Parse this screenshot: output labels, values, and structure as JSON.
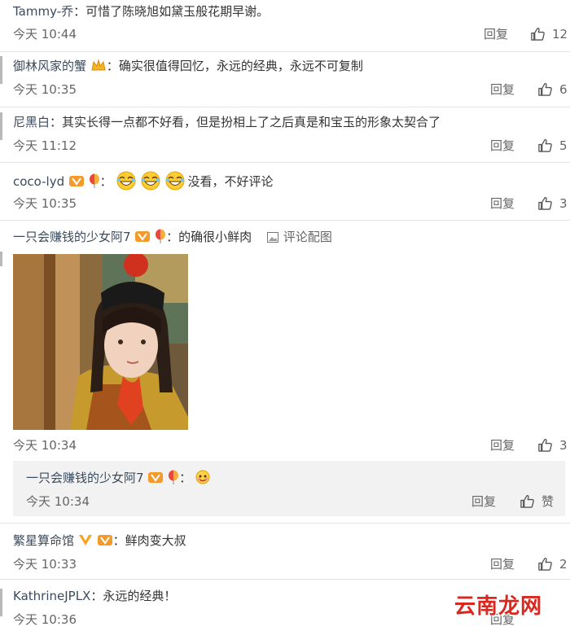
{
  "comments": [
    {
      "user": "Tammy-乔",
      "sep": "：",
      "text": "可惜了陈晓旭如黛玉般花期早谢。",
      "time": "今天 10:44",
      "reply": "回复",
      "likes": "12"
    },
    {
      "user": "御林风家的蟹",
      "sep": "：",
      "text": "确实很值得回忆，永远的经典，永远不可复制",
      "time": "今天 10:35",
      "reply": "回复",
      "likes": "6"
    },
    {
      "user": "尼黑白",
      "sep": "：",
      "text": "其实长得一点都不好看，但是扮相上了之后真是和宝玉的形象太契合了",
      "time": "今天 11:12",
      "reply": "回复",
      "likes": "5"
    },
    {
      "user": "coco-lyd",
      "sep": "：",
      "text": "没看，不好评论",
      "time": "今天 10:35",
      "reply": "回复",
      "likes": "3"
    },
    {
      "user": "一只会赚钱的少女阿7",
      "sep": "：",
      "text": "的确很小鲜肉",
      "tag": "评论配图",
      "time": "今天 10:34",
      "reply": "回复",
      "likes": "3"
    },
    {
      "user": "繁星算命馆",
      "sep": "：",
      "text": "鲜肉变大叔",
      "time": "今天 10:33",
      "reply": "回复",
      "likes": "2"
    },
    {
      "user": "KathrineJPLX",
      "sep": "：",
      "text": "永远的经典！",
      "time": "今天 10:36",
      "reply": "回复"
    }
  ],
  "nested_reply": {
    "user": "一只会赚钱的少女阿7",
    "sep": "：",
    "time": "今天 10:34",
    "reply": "回复",
    "like_label": "赞"
  },
  "watermark": "云南龙网",
  "colors": {
    "username": "#3b4a5c",
    "text": "#333333",
    "meta": "#666666",
    "divider": "#e4e4e4",
    "reply_bg": "#f2f2f2",
    "watermark": "#d8281f"
  }
}
